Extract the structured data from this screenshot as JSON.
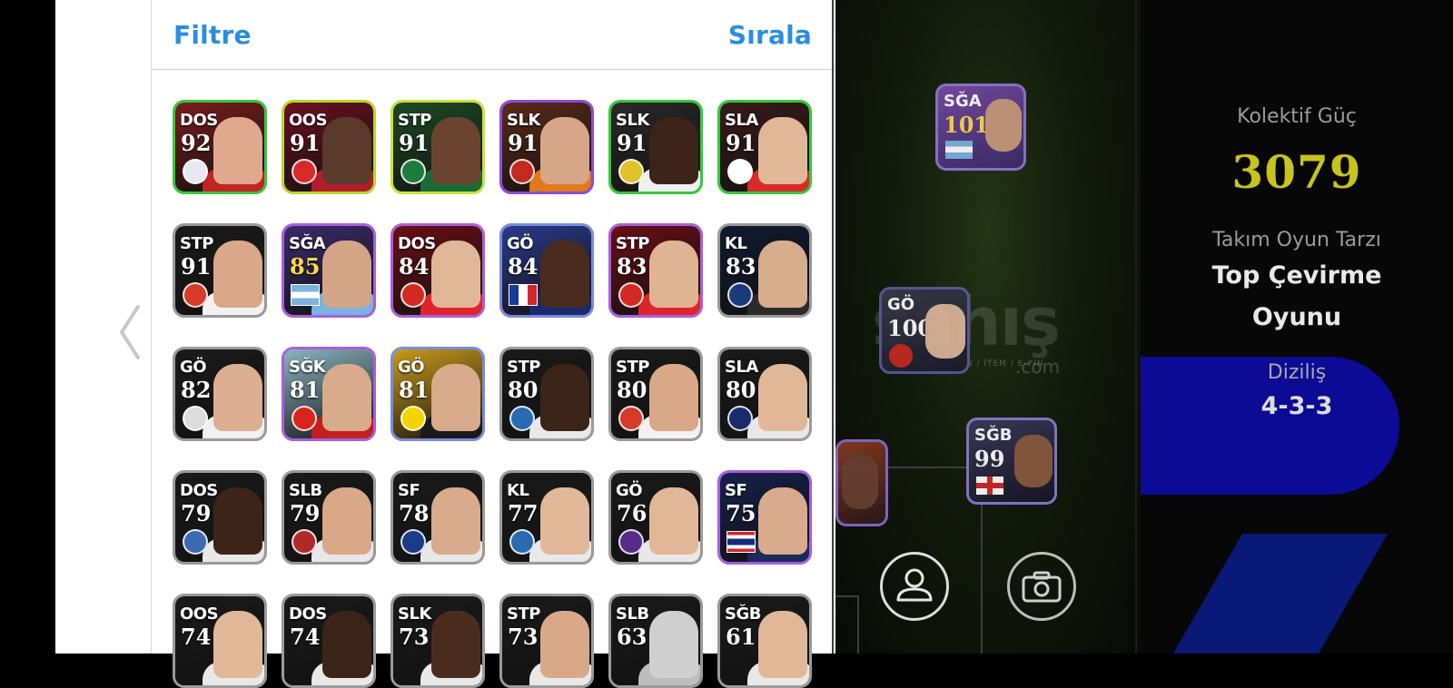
{
  "header": {
    "filter_label": "Filtre",
    "sort_label": "Sırala"
  },
  "players": [
    {
      "pos": "DOS",
      "rating": "92",
      "frame": "#35c83a",
      "bg": "#7a1c1c",
      "shirt": "#c22323",
      "skin": "#e0a98e",
      "badge": "#e8e8f0"
    },
    {
      "pos": "OOS",
      "rating": "91",
      "frame": "#b8d82a",
      "bg": "#6a1020",
      "shirt": "#b31d2b",
      "skin": "#5a3a2a",
      "badge": "#d72a2a"
    },
    {
      "pos": "STP",
      "rating": "91",
      "frame": "#c9e23a",
      "bg": "#1e4a24",
      "shirt": "#1b6b3a",
      "skin": "#6b4431",
      "badge": "#1c7a3a"
    },
    {
      "pos": "SLK",
      "rating": "91",
      "frame": "#8a4be0",
      "bg": "#5a2a1a",
      "shirt": "#e07a1a",
      "skin": "#d7a689",
      "badge": "#c5281f"
    },
    {
      "pos": "SLK",
      "rating": "91",
      "frame": "#35c83a",
      "bg": "#2a2a2a",
      "shirt": "#f0f0f0",
      "skin": "#3d2418",
      "badge": "#e0c22a"
    },
    {
      "pos": "SLA",
      "rating": "91",
      "frame": "#35c83a",
      "bg": "#3a1a1a",
      "shirt": "#d82a2a",
      "skin": "#e0b898",
      "badge": "#ffffff"
    },
    {
      "pos": "STP",
      "rating": "91",
      "frame": "#9a9a9a",
      "bg": "#1a1a1a",
      "shirt": "#f2f2f2",
      "skin": "#d8a889",
      "badge": "#d83a2a"
    },
    {
      "pos": "SĞA",
      "rating": "85",
      "frame": "#a75ee0",
      "bg": "#3a2a6a",
      "shirt": "#7ab3e0",
      "skin": "#d4a486",
      "flag": "ar",
      "gold": true
    },
    {
      "pos": "DOS",
      "rating": "84",
      "frame": "#a75ee0",
      "bg": "#6a0e16",
      "shirt": "#e0242a",
      "skin": "#e0b898",
      "badge": "#d22a22"
    },
    {
      "pos": "GÖ",
      "rating": "84",
      "frame": "#7a8ae0",
      "bg": "#2a3a8a",
      "shirt": "#1a2a6a",
      "skin": "#4a2c1e",
      "flag": "fr"
    },
    {
      "pos": "STP",
      "rating": "83",
      "frame": "#a75ee0",
      "bg": "#6a0e16",
      "shirt": "#e0242a",
      "skin": "#dfb494",
      "badge": "#d22a22"
    },
    {
      "pos": "KL",
      "rating": "83",
      "frame": "#9a9a9a",
      "bg": "#101a30",
      "shirt": "#2a2a2a",
      "skin": "#d8ad8e",
      "badge": "#1a3a7a"
    },
    {
      "pos": "GÖ",
      "rating": "82",
      "frame": "#9a9a9a",
      "bg": "#1a1a1a",
      "shirt": "#f0f0f0",
      "skin": "#dcae92",
      "badge": "#dcdcdc"
    },
    {
      "pos": "SĞK",
      "rating": "81",
      "frame": "#a75ee0",
      "bg": "#8ab4c0",
      "shirt": "#c22020",
      "skin": "#d8ab8c",
      "badge": "#d8241c"
    },
    {
      "pos": "GÖ",
      "rating": "81",
      "frame": "#7a8ae0",
      "bg": "#c89a1a",
      "shirt": "#1a1a1a",
      "skin": "#d8ab8c",
      "badge": "#f2d500"
    },
    {
      "pos": "STP",
      "rating": "80",
      "frame": "#9a9a9a",
      "bg": "#1a1a1a",
      "shirt": "#e8e8e8",
      "skin": "#3d2418",
      "badge": "#2a6ab0"
    },
    {
      "pos": "STP",
      "rating": "80",
      "frame": "#9a9a9a",
      "bg": "#1a1a1a",
      "shirt": "#f2f2f2",
      "skin": "#d8a889",
      "badge": "#d83a2a"
    },
    {
      "pos": "SLA",
      "rating": "80",
      "frame": "#9a9a9a",
      "bg": "#1a1a1a",
      "shirt": "#e8e8e8",
      "skin": "#e0b898",
      "badge": "#1a2a6a"
    },
    {
      "pos": "DOS",
      "rating": "79",
      "frame": "#9a9a9a",
      "bg": "#1a1a1a",
      "shirt": "#e8e8e8",
      "skin": "#3d2418",
      "badge": "#3a6ab0"
    },
    {
      "pos": "SLB",
      "rating": "79",
      "frame": "#9a9a9a",
      "bg": "#1a1a1a",
      "shirt": "#e8e8e8",
      "skin": "#d8a889",
      "badge": "#b02a2a"
    },
    {
      "pos": "SF",
      "rating": "78",
      "frame": "#9a9a9a",
      "bg": "#1a1a1a",
      "shirt": "#e8e8e8",
      "skin": "#d8ab8c",
      "badge": "#1a3a8a"
    },
    {
      "pos": "KL",
      "rating": "77",
      "frame": "#9a9a9a",
      "bg": "#1a1a1a",
      "shirt": "#e8e8e8",
      "skin": "#e0b898",
      "badge": "#2a6ab0"
    },
    {
      "pos": "GÖ",
      "rating": "76",
      "frame": "#9a9a9a",
      "bg": "#1a1a1a",
      "shirt": "#e8e8e8",
      "skin": "#e0b898",
      "badge": "#5a2a8a"
    },
    {
      "pos": "SF",
      "rating": "75",
      "frame": "#a75ee0",
      "bg": "#16204a",
      "shirt": "#1a2a5a",
      "skin": "#d8ab8c",
      "flag": "th"
    },
    {
      "pos": "OOS",
      "rating": "74",
      "frame": "#9a9a9a",
      "bg": "#1a1a1a",
      "shirt": "#e8e8e8",
      "skin": "#e0b898"
    },
    {
      "pos": "DOS",
      "rating": "74",
      "frame": "#9a9a9a",
      "bg": "#1a1a1a",
      "shirt": "#e8e8e8",
      "skin": "#3d2418"
    },
    {
      "pos": "SLK",
      "rating": "73",
      "frame": "#9a9a9a",
      "bg": "#1a1a1a",
      "shirt": "#e8e8e8",
      "skin": "#4a2c1e"
    },
    {
      "pos": "STP",
      "rating": "73",
      "frame": "#9a9a9a",
      "bg": "#1a1a1a",
      "shirt": "#e8e8e8",
      "skin": "#d8a889"
    },
    {
      "pos": "SLB",
      "rating": "63",
      "frame": "#9a9a9a",
      "bg": "#1a1a1a",
      "shirt": "#bdbdbd",
      "skin": "#cfcfcf"
    },
    {
      "pos": "SĞB",
      "rating": "61",
      "frame": "#9a9a9a",
      "bg": "#1a1a1a",
      "shirt": "#e8e8e8",
      "skin": "#e0b898"
    }
  ],
  "pitch": {
    "watermark": "sahış",
    "watermark_sub": "HESAP / SKIN / İTEM / E-PIN",
    "watermark_com": ".com",
    "cards": [
      {
        "pos": "SĞA",
        "rating": "101",
        "gold": true
      },
      {
        "pos": "GÖ",
        "rating": "100"
      },
      {
        "pos": "SĞB",
        "rating": "99"
      }
    ]
  },
  "stats": {
    "power_label": "Kolektif Güç",
    "power_value": "3079",
    "style_label": "Takım Oyun Tarzı",
    "style_value_line1": "Top Çevirme",
    "style_value_line2": "Oyunu",
    "formation_label": "Diziliş",
    "formation_value": "4-3-3"
  },
  "colors": {
    "accent": "#2b8de0",
    "power": "#c7c21e"
  }
}
